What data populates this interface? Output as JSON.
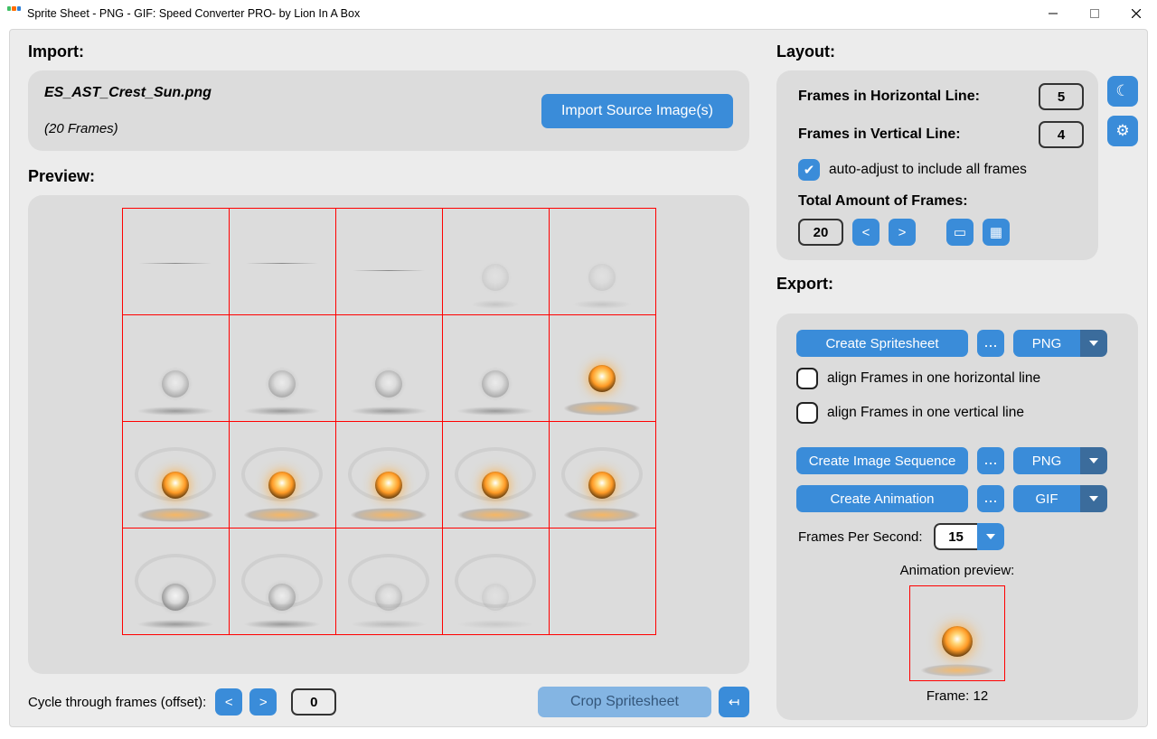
{
  "window": {
    "title": "Sprite Sheet - PNG - GIF: Speed Converter PRO- by Lion In A Box"
  },
  "import": {
    "heading": "Import:",
    "filename": "ES_AST_Crest_Sun.png",
    "frame_count_label": "(20 Frames)",
    "import_button": "Import Source Image(s)"
  },
  "preview": {
    "heading": "Preview:",
    "grid": {
      "cols": 5,
      "rows": 4,
      "total": 20
    }
  },
  "bottom": {
    "cycle_label": "Cycle through frames (offset):",
    "prev": "<",
    "next": ">",
    "offset_value": "0",
    "crop_button": "Crop Spritesheet",
    "revert": "↤"
  },
  "layout": {
    "heading": "Layout:",
    "frames_h_label": "Frames in Horizontal Line:",
    "frames_h_value": "5",
    "frames_v_label": "Frames in Vertical Line:",
    "frames_v_value": "4",
    "auto_adjust_label": "auto-adjust to include all frames",
    "auto_adjust_checked": true,
    "total_label": "Total Amount of Frames:",
    "total_value": "20",
    "prev": "<",
    "next": ">",
    "side_btn1_icon": "moon",
    "side_btn2_icon": "gear"
  },
  "export": {
    "heading": "Export:",
    "create_spritesheet": "Create Spritesheet",
    "dots": "...",
    "format_spritesheet": "PNG",
    "align_h_label": "align Frames in one horizontal line",
    "align_v_label": "align Frames in one vertical line",
    "create_sequence": "Create Image Sequence",
    "format_sequence": "PNG",
    "create_animation": "Create Animation",
    "format_animation": "GIF",
    "fps_label": "Frames Per Second:",
    "fps_value": "15",
    "anim_preview_label": "Animation preview:",
    "anim_frame_label": "Frame: 12"
  }
}
